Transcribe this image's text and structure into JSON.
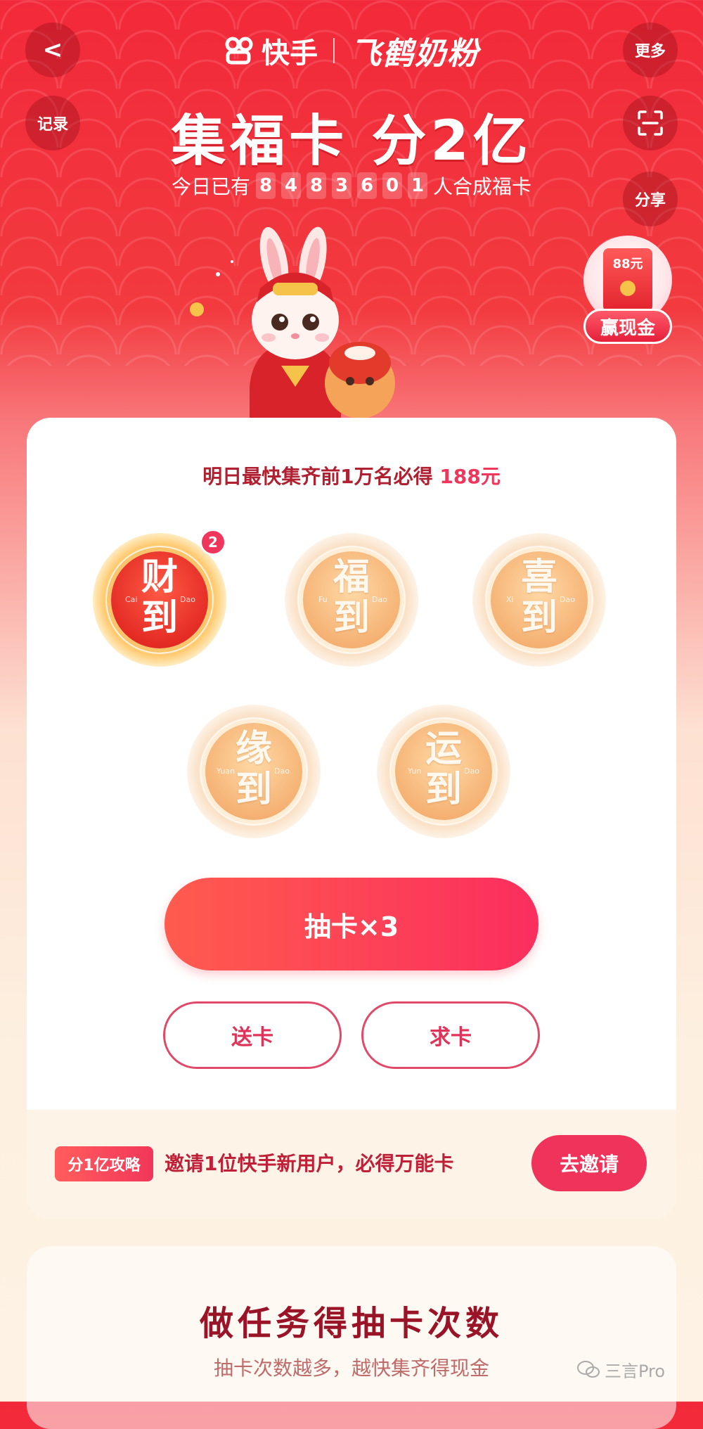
{
  "header": {
    "back_label": "<",
    "record_label": "记录",
    "more_label": "更多",
    "share_label": "分享",
    "brand_primary": "快手",
    "brand_partner": "飞鹤奶粉",
    "title": "集福卡 分2亿",
    "counter_prefix": "今日已有",
    "counter_digits": [
      "8",
      "4",
      "8",
      "3",
      "6",
      "0",
      "1"
    ],
    "counter_suffix": "人合成福卡"
  },
  "cash_badge": {
    "envelope_amount": "88元",
    "label": "赢现金"
  },
  "main": {
    "subtitle_prefix": "明日最快集齐前1万名必得",
    "subtitle_amount": "188元",
    "cards": [
      {
        "top": "财",
        "bottom": "到",
        "pinyin_left": "Cai",
        "pinyin_right": "Dao",
        "count": "2",
        "owned": true
      },
      {
        "top": "福",
        "bottom": "到",
        "pinyin_left": "Fu",
        "pinyin_right": "Dao",
        "owned": false
      },
      {
        "top": "喜",
        "bottom": "到",
        "pinyin_left": "Xi",
        "pinyin_right": "Dao",
        "owned": false
      },
      {
        "top": "缘",
        "bottom": "到",
        "pinyin_left": "Yuan",
        "pinyin_right": "Dao",
        "owned": false
      },
      {
        "top": "运",
        "bottom": "到",
        "pinyin_left": "Yun",
        "pinyin_right": "Dao",
        "owned": false
      }
    ],
    "draw_button": "抽卡×3",
    "send_button": "送卡",
    "ask_button": "求卡"
  },
  "invite": {
    "tag": "分1亿攻略",
    "text": "邀请1位快手新用户，必得万能卡",
    "button": "去邀请"
  },
  "tasks": {
    "title": "做任务得抽卡次数",
    "subtitle": "抽卡次数越多，越快集齐得现金"
  },
  "watermark": "三言Pro",
  "colors": {
    "header_red": "#f2293a",
    "accent_pink": "#f0365a",
    "card_orange": "#f5b274",
    "card_active_red": "#e42c25"
  }
}
